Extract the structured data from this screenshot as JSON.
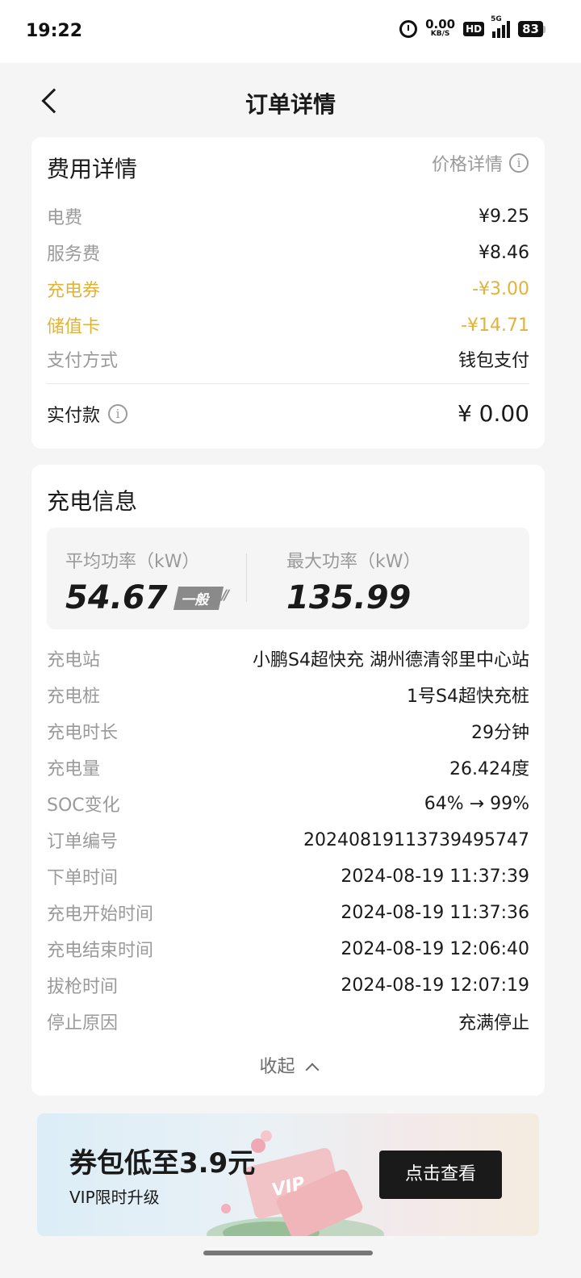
{
  "status_bar": {
    "time": "19:22",
    "net_speed_value": "0.00",
    "net_speed_unit": "KB/S",
    "hd_label": "HD",
    "network_label": "5G",
    "battery_level": "83"
  },
  "nav": {
    "title": "订单详情"
  },
  "fee": {
    "title": "费用详情",
    "price_detail_label": "价格详情",
    "rows": [
      {
        "label": "电费",
        "value": "¥9.25"
      },
      {
        "label": "服务费",
        "value": "¥8.46"
      },
      {
        "label": "充电券",
        "value": "-¥3.00"
      },
      {
        "label": "储值卡",
        "value": "-¥14.71"
      },
      {
        "label": "支付方式",
        "value": "钱包支付"
      }
    ],
    "paid_label": "实付款",
    "paid_value": "¥ 0.00"
  },
  "charge": {
    "title": "充电信息",
    "avg_power_label": "平均功率（kW）",
    "avg_power_value": "54.67",
    "avg_power_badge": "一般",
    "max_power_label": "最大功率（kW）",
    "max_power_value": "135.99",
    "rows": [
      {
        "label": "充电站",
        "value": "小鹏S4超快充 湖州德清邻里中心站"
      },
      {
        "label": "充电桩",
        "value": "1号S4超快充桩"
      },
      {
        "label": "充电时长",
        "value": "29分钟"
      },
      {
        "label": "充电量",
        "value": "26.424度"
      },
      {
        "label": "SOC变化",
        "value": "64% → 99%"
      },
      {
        "label": "订单编号",
        "value": "20240819113739495747"
      },
      {
        "label": "下单时间",
        "value": "2024-08-19 11:37:39"
      },
      {
        "label": "充电开始时间",
        "value": "2024-08-19 11:37:36"
      },
      {
        "label": "充电结束时间",
        "value": "2024-08-19 12:06:40"
      },
      {
        "label": "拔枪时间",
        "value": "2024-08-19 12:07:19"
      },
      {
        "label": "停止原因",
        "value": "充满停止"
      }
    ],
    "collapse_label": "收起"
  },
  "banner": {
    "title": "券包低至3.9元",
    "subtitle": "VIP限时升级",
    "button_label": "点击查看",
    "art_text": "VIP"
  },
  "colors": {
    "discount": "#e0b33a",
    "muted": "#9a9a9a",
    "text": "#1a1a1a"
  }
}
